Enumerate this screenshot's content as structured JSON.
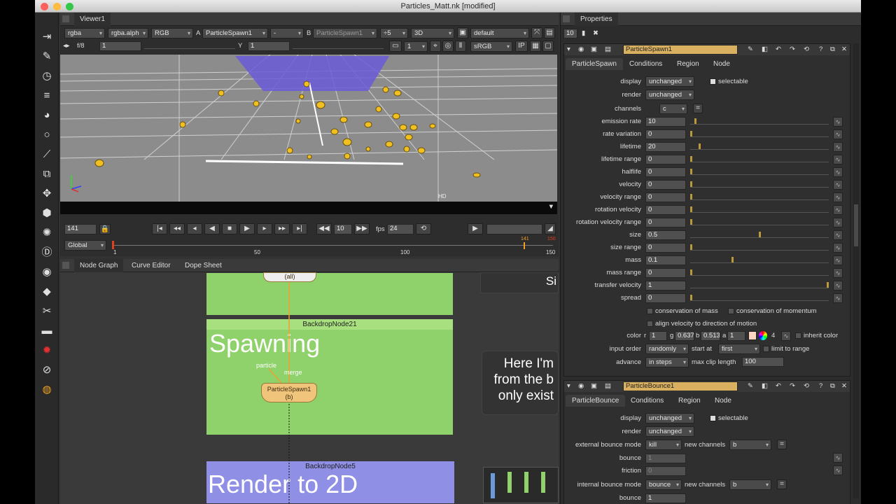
{
  "window": {
    "title": "Particles_Matt.nk [modified]"
  },
  "toolbar": {
    "icons": [
      "viewer-icon",
      "paint-icon",
      "time-icon",
      "channel-icon",
      "color-icon",
      "filter-icon",
      "keyer-icon",
      "merge-icon",
      "transform-icon",
      "3d-icon",
      "particles-icon",
      "deep-icon",
      "views-icon",
      "metadata-icon",
      "other-icon",
      "gizmo-icon",
      "furnace-icon",
      "ofx-icon",
      "nuke-icon"
    ]
  },
  "viewer": {
    "tab": "Viewer1",
    "channels": "rgba",
    "alpha": "rgba.alph",
    "display_channels": "RGB",
    "a_label": "A",
    "a_input": "ParticleSpawn1",
    "blend": "-",
    "b_label": "B",
    "b_input": "ParticleSpawn1",
    "downrez": "÷5",
    "view_mode": "3D",
    "camera": "default",
    "fstop": "f/8",
    "gain": "1",
    "y_label": "Y",
    "gamma": "1",
    "proxy": "1",
    "lut": "sRGB",
    "ip": "IP",
    "format": "HD",
    "frame": "141",
    "inc": "10",
    "fps_label": "fps",
    "fps": "24",
    "range_mode": "Global",
    "timeline_start": "1",
    "tick_50": "50",
    "tick_100": "100",
    "timeline_end": "150",
    "current_marker": "141",
    "end_marker": "150"
  },
  "nodegraph": {
    "tabs": [
      "Node Graph",
      "Curve Editor",
      "Dope Sheet"
    ],
    "top_node": "(all)",
    "bd21_title": "BackdropNode21",
    "bd21_text": "Spawning",
    "bd5_title": "BackdropNode5",
    "bd5_text": "Render to 2D",
    "spawn_node": "ParticleSpawn1",
    "spawn_sub": "(b)",
    "label_particle": "particle",
    "label_merge": "merge",
    "note": [
      "Here I'm",
      "from the b",
      "only exist"
    ],
    "note_cut": "Si"
  },
  "properties": {
    "title": "Properties",
    "max_panels": "10",
    "spawn": {
      "name": "ParticleSpawn1",
      "tabs": [
        "ParticleSpawn",
        "Conditions",
        "Region",
        "Node"
      ],
      "display_label": "display",
      "display": "unchanged",
      "selectable": "selectable",
      "render_label": "render",
      "render": "unchanged",
      "channels_label": "channels",
      "channels": "c",
      "rows": [
        {
          "label": "emission rate",
          "value": "10",
          "frac": 0.03
        },
        {
          "label": "rate variation",
          "value": "0",
          "frac": 0.0
        },
        {
          "label": "lifetime",
          "value": "20",
          "frac": 0.06
        },
        {
          "label": "lifetime range",
          "value": "0",
          "frac": 0.0
        },
        {
          "label": "halflife",
          "value": "0",
          "frac": 0.0
        },
        {
          "label": "velocity",
          "value": "0",
          "frac": 0.0
        },
        {
          "label": "velocity range",
          "value": "0",
          "frac": 0.0
        },
        {
          "label": "rotation velocity",
          "value": "0",
          "frac": 0.0
        },
        {
          "label": "rotation velocity range",
          "value": "0",
          "frac": 0.0
        },
        {
          "label": "size",
          "value": "0.5",
          "frac": 0.5
        },
        {
          "label": "size range",
          "value": "0",
          "frac": 0.0
        },
        {
          "label": "mass",
          "value": "0.1",
          "frac": 0.3
        },
        {
          "label": "mass range",
          "value": "0",
          "frac": 0.0
        },
        {
          "label": "transfer velocity",
          "value": "1",
          "frac": 1.0
        },
        {
          "label": "spread",
          "value": "0",
          "frac": 0.0
        }
      ],
      "cons_mass": "conservation of mass",
      "cons_momentum": "conservation of momentum",
      "align": "align velocity to direction of motion",
      "color_label": "color",
      "r_label": "r",
      "r": "1",
      "g_label": "g",
      "g": "0.637",
      "b_label": "b",
      "b": "0.513",
      "a_label": "a",
      "a": "1",
      "color_count": "4",
      "inherit": "inherit color",
      "input_order_label": "input order",
      "input_order": "randomly",
      "start_at_label": "start at",
      "start_at": "first",
      "limit": "limit to range",
      "advance_label": "advance",
      "advance": "in steps",
      "max_clip_label": "max clip length",
      "max_clip": "100"
    },
    "bounce": {
      "name": "ParticleBounce1",
      "tabs": [
        "ParticleBounce",
        "Conditions",
        "Region",
        "Node"
      ],
      "display_label": "display",
      "display": "unchanged",
      "selectable": "selectable",
      "render_label": "render",
      "render": "unchanged",
      "ext_label": "external bounce mode",
      "ext": "kill",
      "new_ch_label": "new channels",
      "ext_ch": "b",
      "bounce_label": "bounce",
      "bounce": "1",
      "friction_label": "friction",
      "friction": "0",
      "int_label": "internal bounce mode",
      "int": "bounce",
      "int_ch": "b",
      "bounce2_label": "bounce",
      "bounce2": "1"
    }
  },
  "colors": {
    "accent": "#f0b43c",
    "backdrop_green": "#8fd16a",
    "backdrop_blue": "#8f8fe6"
  }
}
